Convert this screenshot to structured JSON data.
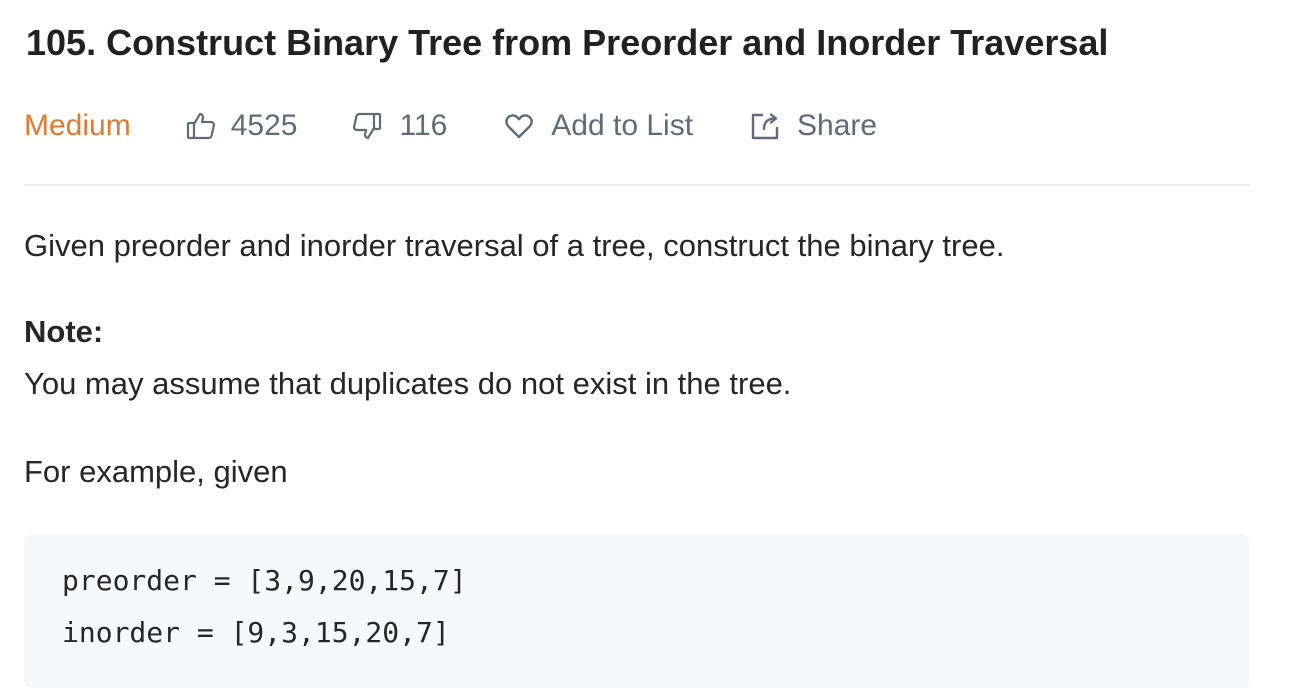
{
  "problem": {
    "title": "105. Construct Binary Tree from Preorder and Inorder Traversal",
    "difficulty": "Medium",
    "difficulty_color": "#e07a2f",
    "likes": "4525",
    "dislikes": "116",
    "add_to_list_label": "Add to List",
    "share_label": "Share",
    "icons": {
      "likes": "thumbs-up-icon",
      "dislikes": "thumbs-down-icon",
      "add_to_list": "heart-icon",
      "share": "share-icon"
    }
  },
  "description": {
    "intro": "Given preorder and inorder traversal of a tree, construct the binary tree.",
    "note_heading": "Note:",
    "note_text": "You may assume that duplicates do not exist in the tree.",
    "example_intro": "For example, given"
  },
  "example": {
    "lines": [
      "preorder = [3,9,20,15,7]",
      "inorder = [9,3,15,20,7]"
    ]
  }
}
